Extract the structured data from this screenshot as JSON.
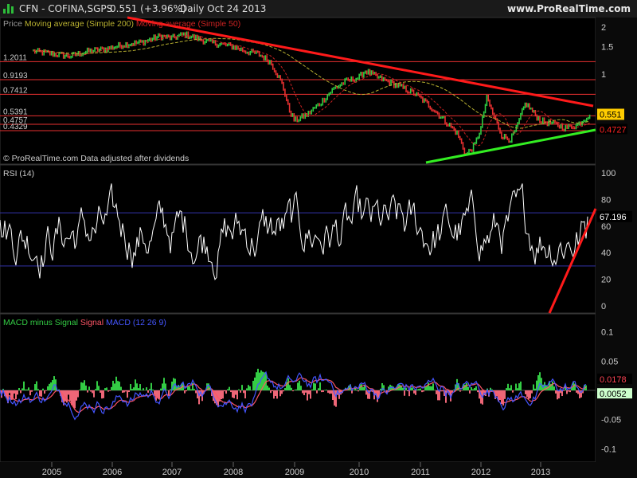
{
  "header": {
    "symbol": "CFN - COFINA,SGPS",
    "quote": "0.551 (+3.96%)",
    "period": "Daily  Oct 24 2013",
    "site": "www.ProRealTime.com"
  },
  "colors": {
    "price_up": "#2ecc40",
    "price_down": "#e83030",
    "ma200": "#b8b030",
    "ma50": "#cc2222",
    "trend_red": "#ff1a1a",
    "trend_green": "#33ee22",
    "rsi": "#ffffff",
    "macd": "#4455ff",
    "signal": "#ff5566",
    "hist_pos": "#33cc44",
    "hist_neg": "#ee6677",
    "band": "#3333aa"
  },
  "chart_data": [
    {
      "type": "line",
      "name": "price-panel",
      "legend": [
        "Price",
        "Moving average (Simple 200)",
        "Moving average (Simple 50)"
      ],
      "note": "© ProRealTime.com  Data adjusted after dividends",
      "x": [
        "2005",
        "2006",
        "2007",
        "2008",
        "2009",
        "2010",
        "2011",
        "2012",
        "2013"
      ],
      "yscale": "log",
      "yticks": [
        "2",
        "1.5",
        "1"
      ],
      "horizontal_levels": [
        {
          "label": "1.2011",
          "value": 1.2011
        },
        {
          "label": "0.9193",
          "value": 0.9193
        },
        {
          "label": "0.7412",
          "value": 0.7412
        },
        {
          "label": "0.5391",
          "value": 0.5391
        },
        {
          "label": "0.4757",
          "value": 0.4757
        },
        {
          "label": "0.4329",
          "value": 0.4329
        }
      ],
      "last_price": {
        "label": "0.551",
        "value": 0.551
      },
      "last_ma": {
        "label": "0.4727",
        "value": 0.4727
      },
      "approx_series": {
        "dates": [
          2004.7,
          2005.0,
          2005.3,
          2005.6,
          2005.9,
          2006.2,
          2006.5,
          2006.8,
          2007.0,
          2007.2,
          2007.4,
          2007.6,
          2007.8,
          2008.0,
          2008.2,
          2008.4,
          2008.6,
          2008.8,
          2008.9,
          2009.0,
          2009.2,
          2009.4,
          2009.6,
          2009.8,
          2010.0,
          2010.1,
          2010.3,
          2010.6,
          2010.9,
          2011.1,
          2011.4,
          2011.6,
          2011.75,
          2011.9,
          2012.0,
          2012.1,
          2012.2,
          2012.35,
          2012.5,
          2012.6,
          2012.75,
          2012.9,
          2013.0,
          2013.2,
          2013.4,
          2013.6,
          2013.8
        ],
        "close": [
          1.4,
          1.35,
          1.3,
          1.4,
          1.45,
          1.55,
          1.6,
          1.75,
          1.7,
          1.8,
          1.7,
          1.6,
          1.55,
          1.5,
          1.4,
          1.35,
          1.2,
          0.85,
          0.6,
          0.5,
          0.55,
          0.65,
          0.8,
          0.9,
          0.95,
          1.05,
          0.95,
          0.85,
          0.75,
          0.65,
          0.5,
          0.42,
          0.3,
          0.35,
          0.45,
          0.7,
          0.55,
          0.4,
          0.38,
          0.45,
          0.65,
          0.55,
          0.5,
          0.48,
          0.45,
          0.47,
          0.551
        ]
      }
    },
    {
      "type": "line",
      "name": "RSI (14)",
      "ylim": [
        0,
        100
      ],
      "yticks": [
        "100",
        "80",
        "60",
        "40",
        "20",
        "0"
      ],
      "bands": [
        70,
        30
      ],
      "last": {
        "label": "67.196",
        "value": 67.196
      }
    },
    {
      "type": "line",
      "name": "MACD (12 26 9)",
      "legend": [
        "MACD minus Signal",
        "Signal",
        "MACD (12 26 9)"
      ],
      "ylim": [
        -0.12,
        0.12
      ],
      "yticks": [
        "0.1",
        "0.05",
        "-0.05",
        "-0.1"
      ],
      "signal_last": {
        "label": "0.0178",
        "value": 0.0178
      },
      "macd_last": {
        "label": "0.0052",
        "value": 0.0052
      }
    }
  ]
}
